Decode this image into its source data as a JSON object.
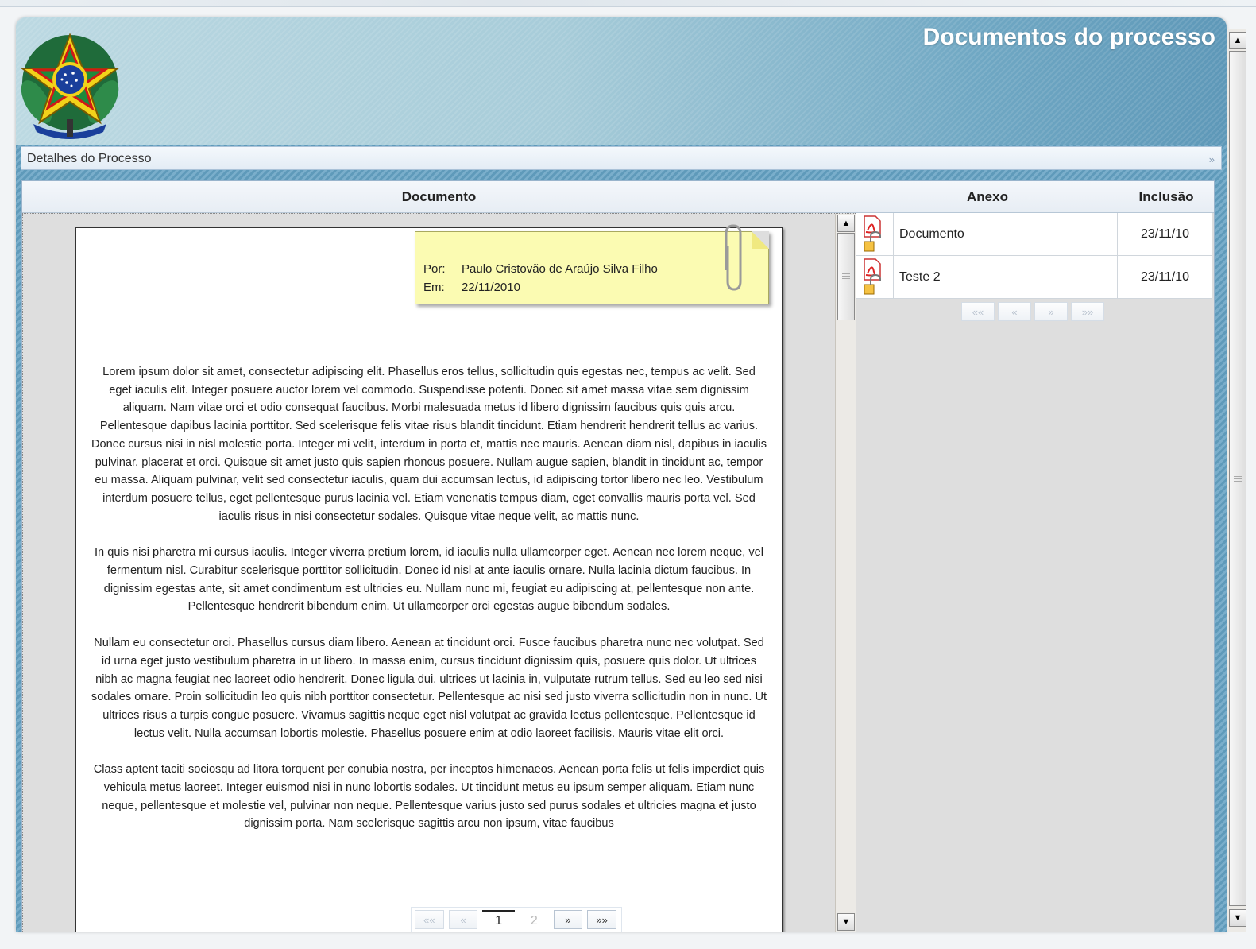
{
  "window": {
    "title": "Documentos do processo"
  },
  "details_bar": {
    "label": "Detalhes do Processo",
    "toggle": "»"
  },
  "columns": {
    "documento": "Documento",
    "anexo": "Anexo",
    "inclusao": "Inclusão"
  },
  "note": {
    "por_label": "Por:",
    "por_value": "Paulo Cristovão de Araújo Silva Filho",
    "em_label": "Em:",
    "em_value": "22/11/2010"
  },
  "document": {
    "paragraphs": [
      "Lorem ipsum dolor sit amet, consectetur adipiscing elit. Phasellus eros tellus, sollicitudin quis egestas nec, tempus ac velit. Sed eget iaculis elit. Integer posuere auctor lorem vel commodo. Suspendisse potenti. Donec sit amet massa vitae sem dignissim aliquam. Nam vitae orci et odio consequat faucibus. Morbi malesuada metus id libero dignissim faucibus quis quis arcu. Pellentesque dapibus lacinia porttitor. Sed scelerisque felis vitae risus blandit tincidunt. Etiam hendrerit hendrerit tellus ac varius. Donec cursus nisi in nisl molestie porta. Integer mi velit, interdum in porta et, mattis nec mauris. Aenean diam nisl, dapibus in iaculis pulvinar, placerat et orci. Quisque sit amet justo quis sapien rhoncus posuere. Nullam augue sapien, blandit in tincidunt ac, tempor eu massa. Aliquam pulvinar, velit sed consectetur iaculis, quam dui accumsan lectus, id adipiscing tortor libero nec leo. Vestibulum interdum posuere tellus, eget pellentesque purus lacinia vel. Etiam venenatis tempus diam, eget convallis mauris porta vel. Sed iaculis risus in nisi consectetur sodales. Quisque vitae neque velit, ac mattis nunc.",
      "In quis nisi pharetra mi cursus iaculis. Integer viverra pretium lorem, id iaculis nulla ullamcorper eget. Aenean nec lorem neque, vel fermentum nisl. Curabitur scelerisque porttitor sollicitudin. Donec id nisl at ante iaculis ornare. Nulla lacinia dictum faucibus. In dignissim egestas ante, sit amet condimentum est ultricies eu. Nullam nunc mi, feugiat eu adipiscing at, pellentesque non ante. Pellentesque hendrerit bibendum enim. Ut ullamcorper orci egestas augue bibendum sodales.",
      "Nullam eu consectetur orci. Phasellus cursus diam libero. Aenean at tincidunt orci. Fusce faucibus pharetra nunc nec volutpat. Sed id urna eget justo vestibulum pharetra in ut libero. In massa enim, cursus tincidunt dignissim quis, posuere quis dolor. Ut ultrices nibh ac magna feugiat nec laoreet odio hendrerit. Donec ligula dui, ultrices ut lacinia in, vulputate rutrum tellus. Sed eu leo sed nisi sodales ornare. Proin sollicitudin leo quis nibh porttitor consectetur. Pellentesque ac nisi sed justo viverra sollicitudin non in nunc. Ut ultrices risus a turpis congue posuere. Vivamus sagittis neque eget nisl volutpat ac gravida lectus pellentesque. Pellentesque id lectus velit. Nulla accumsan lobortis molestie. Phasellus posuere enim at odio laoreet facilisis. Mauris vitae elit orci.",
      "Class aptent taciti sociosqu ad litora torquent per conubia nostra, per inceptos himenaeos. Aenean porta felis ut felis imperdiet quis vehicula metus laoreet. Integer euismod nisi in nunc lobortis sodales. Ut tincidunt metus eu ipsum semper aliquam. Etiam nunc neque, pellentesque et molestie vel, pulvinar non neque. Pellentesque varius justo sed purus sodales et ultricies magna et justo dignissim porta. Nam scelerisque sagittis arcu non ipsum, vitae faucibus"
    ],
    "pager": {
      "first": "««",
      "prev": "«",
      "page1": "1",
      "page2": "2",
      "next": "»",
      "last": "»»"
    }
  },
  "attachments": [
    {
      "name": "Documento",
      "date": "23/11/10",
      "icon": "pdf-locked-icon"
    },
    {
      "name": "Teste 2",
      "date": "23/11/10",
      "icon": "pdf-locked-icon"
    }
  ],
  "attachments_pager": {
    "first": "««",
    "prev": "«",
    "next": "»",
    "last": "»»"
  },
  "icons": {
    "emblem": "brazil-coat-of-arms",
    "clip": "paperclip-icon"
  },
  "colors": {
    "header_start": "#bcd9e2",
    "header_end": "#5e98b8",
    "note_bg": "#fbfbb2"
  }
}
